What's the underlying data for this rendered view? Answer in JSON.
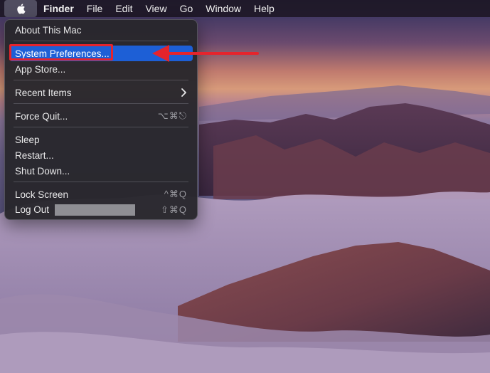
{
  "menubar": {
    "items": [
      "Finder",
      "File",
      "Edit",
      "View",
      "Go",
      "Window",
      "Help"
    ],
    "active_app": "Finder"
  },
  "apple_menu": {
    "items": {
      "about": {
        "label": "About This Mac"
      },
      "system_preferences": {
        "label": "System Preferences...",
        "highlighted": true
      },
      "app_store": {
        "label": "App Store..."
      },
      "recent_items": {
        "label": "Recent Items"
      },
      "force_quit": {
        "label": "Force Quit...",
        "shortcut": "⌥⌘⎋"
      },
      "sleep": {
        "label": "Sleep"
      },
      "restart": {
        "label": "Restart..."
      },
      "shut_down": {
        "label": "Shut Down..."
      },
      "lock_screen": {
        "label": "Lock Screen",
        "shortcut": "^⌘Q"
      },
      "log_out": {
        "label": "Log Out",
        "shortcut": "⇧⌘Q"
      }
    }
  },
  "colors": {
    "selection": "#1d5fd6",
    "annotation": "#e5242c",
    "menu_bg": "#28262c"
  },
  "icons": [
    "apple-logo-icon",
    "chevron-right-icon",
    "annotation-arrow-icon"
  ]
}
